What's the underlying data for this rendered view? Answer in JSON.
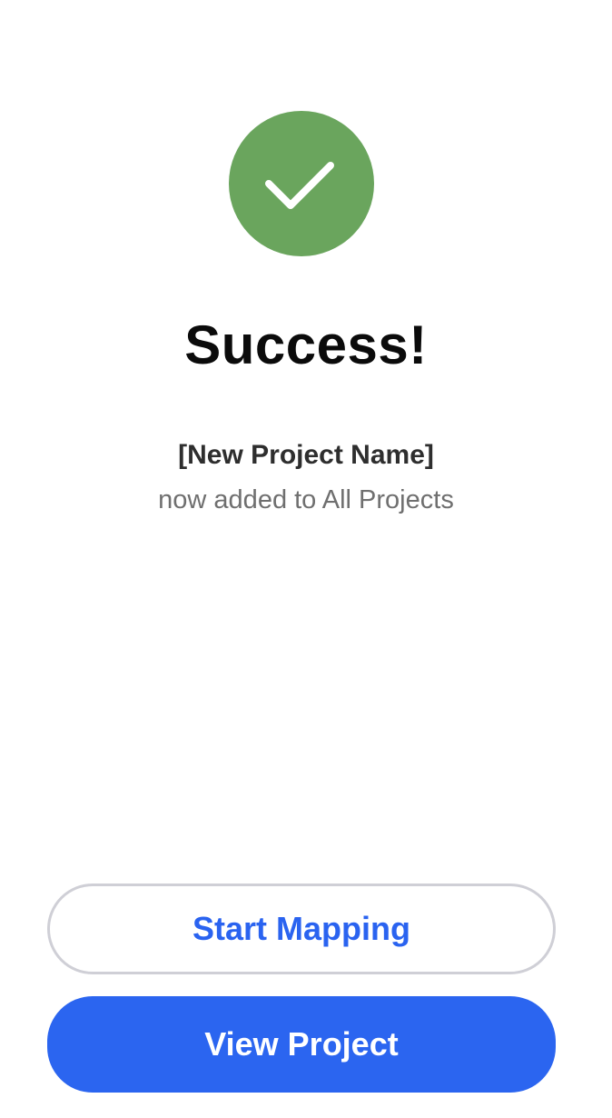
{
  "success": {
    "icon": "checkmark-icon",
    "icon_color": "#6aa55d",
    "title": "Success!",
    "project_name": "[New Project Name]",
    "message": "now added to All Projects"
  },
  "actions": {
    "start_mapping_label": "Start Mapping",
    "view_project_label": "View Project",
    "primary_color": "#2b65f0"
  }
}
